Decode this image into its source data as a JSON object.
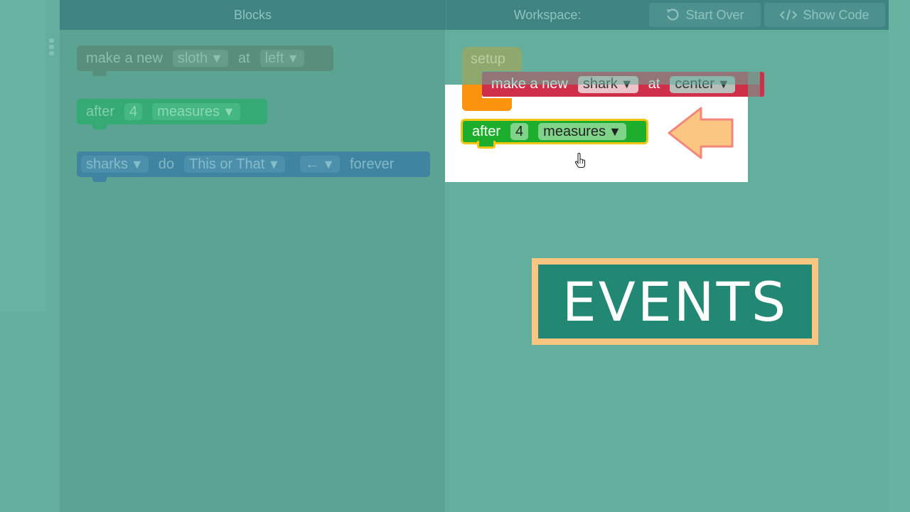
{
  "header": {
    "blocks_title": "Blocks",
    "workspace_title": "Workspace:",
    "start_over_label": "Start Over",
    "show_code_label": "Show Code"
  },
  "toolbox": {
    "make_block": {
      "prefix": "make a new",
      "character": "sloth",
      "at_label": "at",
      "position": "left"
    },
    "after_block": {
      "prefix": "after",
      "count": "4",
      "unit": "measures"
    },
    "sharks_block": {
      "target": "sharks",
      "do_label": "do",
      "action": "This or That",
      "direction": "←",
      "suffix": "forever"
    }
  },
  "workspace": {
    "setup_label": "setup",
    "make_block": {
      "prefix": "make a new",
      "character": "shark",
      "at_label": "at",
      "position": "center"
    },
    "after_block": {
      "prefix": "after",
      "count": "4",
      "unit": "measures"
    }
  },
  "callout": {
    "title": "EVENTS"
  },
  "dropdown_glyph": "▼",
  "colors": {
    "header": "#3f8481",
    "toolbox_bg": "#5ba493",
    "workspace_bg": "#63ae9c",
    "events_green": "#1dae2e",
    "highlight_border": "#f4c40f",
    "setup_orange": "#fb930e",
    "make_red": "#d02f4a",
    "callout_border": "#fbc682",
    "callout_fill": "#228874"
  },
  "icons": [
    "refresh-icon",
    "code-icon",
    "hand-cursor-icon",
    "pointer-arrow-icon",
    "grip-icon"
  ]
}
